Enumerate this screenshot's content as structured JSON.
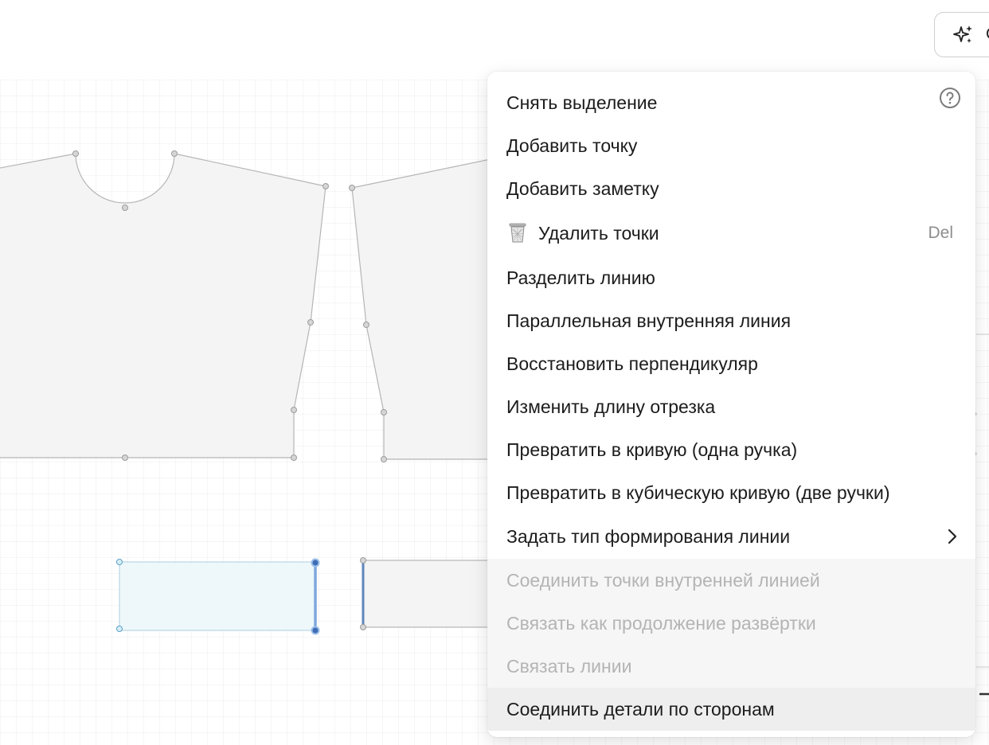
{
  "toolbar": {
    "ai_button_label": "С",
    "ai_icon": "sparkles-icon"
  },
  "canvas": {
    "grid": true,
    "pieces": [
      {
        "name": "front-bodice-piece",
        "selected": false
      },
      {
        "name": "back-bodice-piece",
        "selected": false
      },
      {
        "name": "cuff-piece-left",
        "selected": true
      },
      {
        "name": "cuff-piece-right",
        "selected": false
      }
    ]
  },
  "menu": {
    "help_icon": "question-circle-icon",
    "items": [
      {
        "label": "Снять выделение",
        "disabled": false
      },
      {
        "label": "Добавить точку",
        "disabled": false
      },
      {
        "label": "Добавить заметку",
        "disabled": false
      },
      {
        "label": "Удалить точки",
        "icon": "trash-icon",
        "shortcut": "Del",
        "disabled": false
      },
      {
        "label": "Разделить линию",
        "disabled": false
      },
      {
        "label": "Параллельная внутренняя линия",
        "disabled": false
      },
      {
        "label": "Восстановить перпендикуляр",
        "disabled": false
      },
      {
        "label": "Изменить длину отрезка",
        "disabled": false
      },
      {
        "label": "Превратить в кривую (одна ручка)",
        "disabled": false
      },
      {
        "label": "Превратить в кубическую кривую (две ручки)",
        "disabled": false
      },
      {
        "label": "Задать тип формирования линии",
        "submenu": true,
        "disabled": false
      },
      {
        "label": "Соединить точки внутренней линией",
        "disabled": true
      },
      {
        "label": "Связать как продолжение развёртки",
        "disabled": true
      },
      {
        "label": "Связать линии",
        "disabled": true
      },
      {
        "label": "Соединить детали по сторонам",
        "disabled": false,
        "hovered": true
      }
    ]
  },
  "colors": {
    "piece_fill": "#f4f4f4",
    "piece_stroke": "#b5b5b5",
    "selected_fill": "#eef8fa",
    "selected_edge": "#6f9ed6",
    "disabled_text": "#b4b4b4"
  }
}
